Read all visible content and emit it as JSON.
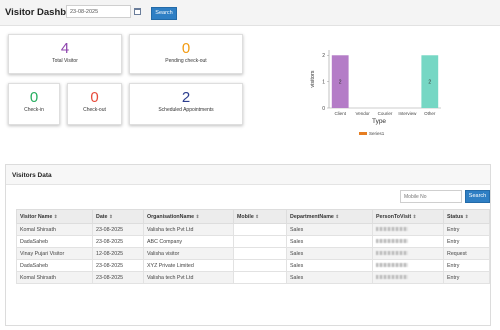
{
  "header": {
    "title": "Visitor Dashboard",
    "date_value": "23-08-2025",
    "search_label": "Search"
  },
  "cards": [
    {
      "value": "4",
      "label": "Total Visitor",
      "color": "#8e44ad"
    },
    {
      "value": "0",
      "label": "Pending check-out",
      "color": "#f39c12"
    },
    {
      "value": "0",
      "label": "Check-in",
      "color": "#27ae60"
    },
    {
      "value": "0",
      "label": "Check-out",
      "color": "#e74c3c"
    },
    {
      "value": "2",
      "label": "Scheduled Appointments",
      "color": "#2c3e8f"
    }
  ],
  "chart_data": {
    "type": "bar",
    "categories": [
      "Client",
      "Vendor",
      "Courier",
      "Interview",
      "Other"
    ],
    "series": [
      {
        "name": "Series1",
        "values": [
          2,
          0,
          0,
          0,
          2
        ]
      }
    ],
    "bar_colors": [
      "#b47cc7",
      "#b47cc7",
      "#b47cc7",
      "#b47cc7",
      "#76d7c4"
    ],
    "data_labels": [
      "2",
      "",
      "",
      "",
      "2"
    ],
    "xlabel": "Type",
    "ylabel": "visitors",
    "yticks": [
      "0",
      "1",
      "2"
    ],
    "ylim": [
      0,
      2.2
    ],
    "legend_color": "#e67e22",
    "legend_position": "bottom"
  },
  "visitors": {
    "title": "Visitors Data",
    "mobile_placeholder": "Mobile No",
    "search_label": "Search",
    "sort_glyph": "⇕",
    "columns": [
      "Visitor Name",
      "Date",
      "OrganisationName",
      "Mobile",
      "DepartmentName",
      "PersonToVisit",
      "Status"
    ],
    "rows": [
      {
        "name": "Komal Shirsath",
        "date": "23-08-2025",
        "org": "Valisha tech Pvt Ltd",
        "dept": "Sales",
        "status": "Entry"
      },
      {
        "name": "DadaSaheb",
        "date": "23-08-2025",
        "org": "ABC Company",
        "dept": "Sales",
        "status": "Entry"
      },
      {
        "name": "Vinay Pujari Visitor",
        "date": "12-08-2025",
        "org": "Valisha visitor",
        "dept": "Sales",
        "status": "Request"
      },
      {
        "name": "DadaSaheb",
        "date": "23-08-2025",
        "org": "XYZ Private Limited",
        "dept": "Sales",
        "status": "Entry"
      },
      {
        "name": "Komal Shirsath",
        "date": "23-08-2025",
        "org": "Valisha tech Pvt Ltd",
        "dept": "Sales",
        "status": "Entry"
      }
    ]
  }
}
